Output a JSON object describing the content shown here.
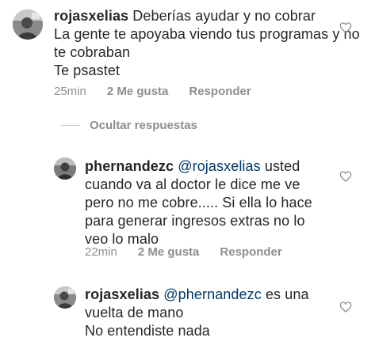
{
  "comments": [
    {
      "username": "rojasxelias",
      "mention": "",
      "text": "Deberías ayudar y no cobrar\nLa gente te apoyaba viendo tus programas y no te cobraban\nTe psastet",
      "time": "25min",
      "likes": "2 Me gusta",
      "reply": "Responder"
    },
    {
      "username": "phernandezc",
      "mention": "@rojasxelias",
      "text": " usted cuando va al doctor le dice me ve pero no me cobre..... Si ella lo hace para generar ingresos extras no lo veo lo malo",
      "time": "22min",
      "likes": "2 Me gusta",
      "reply": "Responder"
    },
    {
      "username": "rojasxelias",
      "mention": "@phernandezc",
      "text": " es una vuelta de mano\nNo entendiste nada",
      "time": "",
      "likes": "",
      "reply": ""
    }
  ],
  "toggle_replies": "Ocultar respuestas",
  "icons": {
    "like": "heart-outline-icon",
    "avatar": "user-avatar"
  },
  "colors": {
    "text": "#262626",
    "secondary": "#8e8e8e",
    "mention": "#00376b"
  }
}
